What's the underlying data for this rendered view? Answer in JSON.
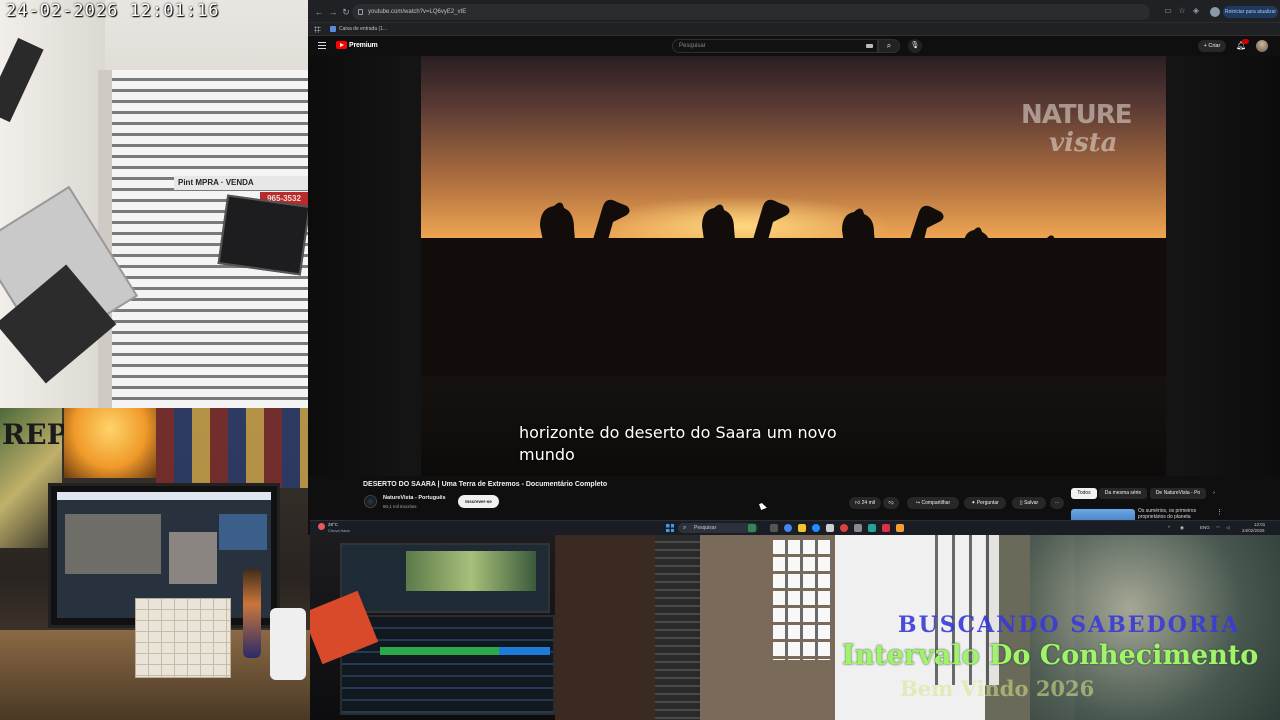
{
  "cameras": {
    "timestamp": "24-02-2026  12:01:16",
    "street_sign": "Pint   MPRA · VENDA",
    "street_sign_phone": "965-3532",
    "mural_text": "REP"
  },
  "overlay": {
    "line1": "BUSCANDO SABEDORIA",
    "line2": "Intervalo Do Conhecimento",
    "line3": "Bem Vindo 2026"
  },
  "browser": {
    "url": "youtube.com/watch?v=LQ6vyE2_vtE",
    "update_button": "Reiniciar para atualizar",
    "bookmark": "Caixa de entrada (1..."
  },
  "youtube": {
    "logo_label": "Premium",
    "search_placeholder": "Pesquisar",
    "create_label": "+ Criar",
    "video_title": "DESERTO DO SAARA | Uma Terra de Extremos - Documentário Completo",
    "subtitle": "horizonte do deserto do Saara um novo mundo",
    "watermark_line1": "NATURE",
    "watermark_line2": "vista",
    "channel_name": "NatureVista - Português",
    "channel_subs": "60,1 mil inscritos",
    "subscribe_label": "Inscrever-se",
    "like_count": "24 mil",
    "share_label": "Compartilhar",
    "ask_label": "Perguntar",
    "save_label": "Salvar",
    "chips": [
      "Todos",
      "Da mesma série",
      "De NatureVista - Po"
    ],
    "recommended_title": "Os sumérios, os primeiros proprietários do planeta"
  },
  "taskbar": {
    "weather_temp": "28°C",
    "weather_condition": "Chuva fraca",
    "search_label": "Pesquisar",
    "time": "12:01",
    "date": "24/02/2026",
    "language": "ENG"
  }
}
